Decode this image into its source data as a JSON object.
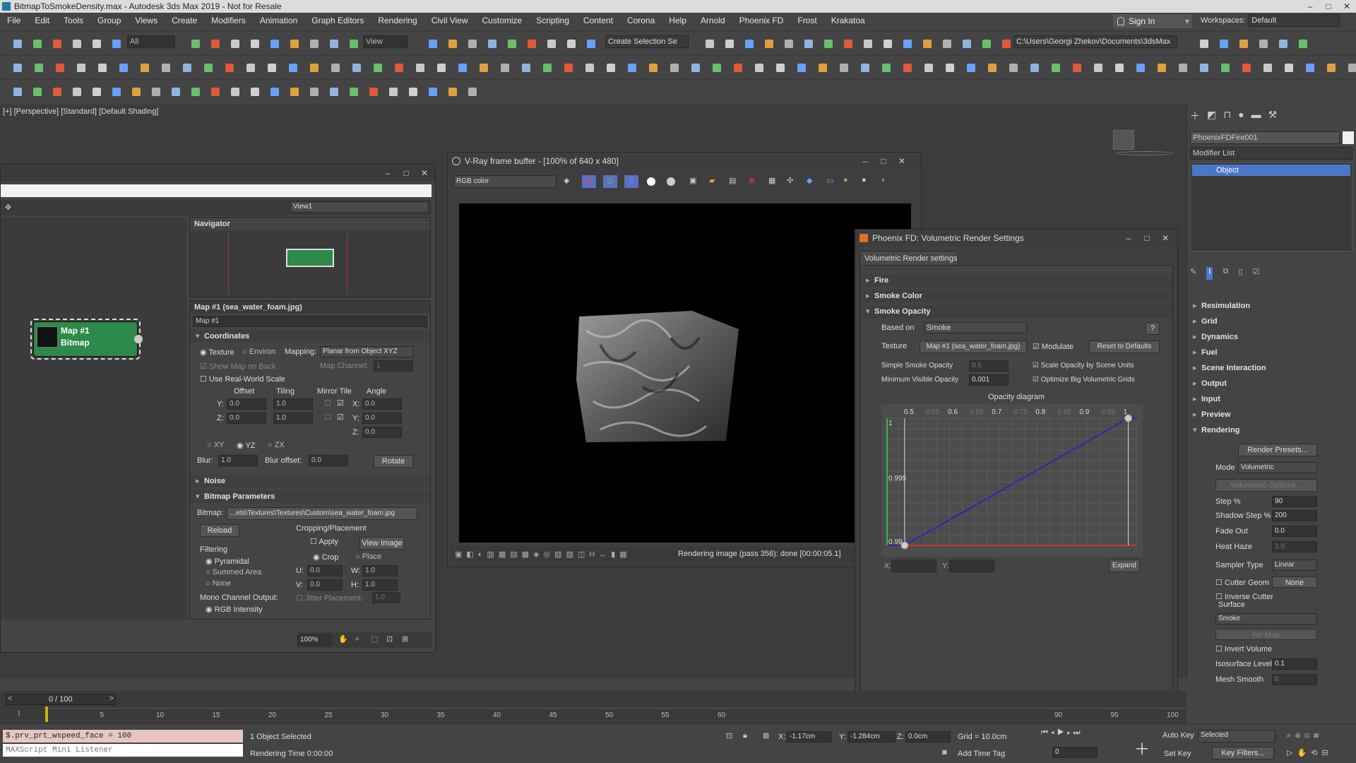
{
  "window": {
    "title": "BitmapToSmokeDensity.max - Autodesk 3ds Max 2019 - Not for Resale",
    "min": "–",
    "max": "□",
    "close": "✕"
  },
  "menu": [
    "File",
    "Edit",
    "Tools",
    "Group",
    "Views",
    "Create",
    "Modifiers",
    "Animation",
    "Graph Editors",
    "Rendering",
    "Civil View",
    "Customize",
    "Scripting",
    "Content",
    "Corona",
    "Help",
    "Arnold",
    "Phoenix FD",
    "Frost",
    "Krakatoa"
  ],
  "signin": "Sign In",
  "workspaces": {
    "label": "Workspaces:",
    "value": "Default"
  },
  "toolbar": {
    "filter": "All",
    "refsys": "View",
    "selset": "Create Selection Se",
    "path": "C:\\Users\\Georgi Zhekov\\Documents\\3dsMax"
  },
  "viewport": {
    "label": "[+] [Perspective] [Standard] [Default Shading]"
  },
  "slate": {
    "viewdd": "View1",
    "navigator": "Navigator",
    "node_line1": "Map #1",
    "node_line2": "Bitmap",
    "zoom": "100%"
  },
  "map": {
    "title": "Map #1 (sea_water_foam.jpg)",
    "name": "Map #1",
    "coordinates": "Coordinates",
    "texture": "Texture",
    "environ": "Environ",
    "mapping_label": "Mapping:",
    "mapping": "Planar from Object XYZ",
    "show_map": "Show Map on Back",
    "map_channel": "Map Channel:",
    "map_channel_val": "1",
    "realworld": "Use Real-World Scale",
    "offset": "Offset",
    "tiling": "Tiling",
    "mirror_tile": "Mirror Tile",
    "angle": "Angle",
    "y": "Y:",
    "z": "Z:",
    "x": "X:",
    "off_y": "0.0",
    "off_z": "0.0",
    "til_y": "1.0",
    "til_z": "1.0",
    "ang_x": "0.0",
    "ang_y": "0.0",
    "ang_z": "0.0",
    "xy": "XY",
    "yz": "YZ",
    "zx": "ZX",
    "blur": "Blur:",
    "blur_val": "1.0",
    "bluroff": "Blur offset:",
    "bluroff_val": "0.0",
    "rotate": "Rotate",
    "noise": "Noise",
    "bitmap_params": "Bitmap Parameters",
    "bitmap_label": "Bitmap:",
    "bitmap_path": "...ets\\Textures\\Textures\\Custom\\sea_water_foam.jpg",
    "reload": "Reload",
    "cropping": "Cropping/Placement",
    "apply": "Apply",
    "view_image": "View Image",
    "crop": "Crop",
    "place": "Place",
    "u": "U:",
    "v": "V:",
    "w": "W:",
    "h": "H:",
    "u_val": "0.0",
    "v_val": "0.0",
    "w_val": "1.0",
    "h_val": "1.0",
    "jitter": "Jitter Placement:",
    "jitter_val": "1.0",
    "filtering": "Filtering",
    "pyramidal": "Pyramidal",
    "summed": "Summed Area",
    "none": "None",
    "mono": "Mono Channel Output:",
    "rgbint": "RGB Intensity"
  },
  "vfb": {
    "title": "V-Ray frame buffer - [100% of 640 x 480]",
    "channel": "RGB color",
    "status": "Rendering image (pass 356): done [00:00:05.1]"
  },
  "phoenix": {
    "title": "Phoenix FD: Volumetric Render Settings",
    "tab": "Volumetric Render settings",
    "fire": "Fire",
    "smoke_color": "Smoke Color",
    "smoke_opacity": "Smoke Opacity",
    "based_on": "Based on",
    "based_val": "Smoke",
    "help": "?",
    "texture": "Texture",
    "texture_map": "Map #1 (sea_water_foam.jpg)",
    "modulate": "Modulate",
    "reset": "Reset to Defaults",
    "simple_opacity": "Simple Smoke Opacity",
    "simple_val": "0.5",
    "scale_opacity": "Scale Opacity by Scene Units",
    "min_visible": "Minimum Visible Opacity",
    "min_val": "0.001",
    "optimize": "Optimize Big Volumetric Grids",
    "diagram_title": "Opacity diagram",
    "ticks": [
      "0.5",
      "0.55",
      "0.6",
      "0.65",
      "0.7",
      "0.75",
      "0.8",
      "0.85",
      "0.9",
      "0.95",
      "1"
    ],
    "yticks": [
      "1",
      "0.995",
      "0.99"
    ],
    "x_label": "X:",
    "y_label": "Y:",
    "expand": "Expand"
  },
  "chart_data": {
    "type": "line",
    "title": "Opacity diagram",
    "xlim": [
      0.45,
      1.02
    ],
    "ylim": [
      0.99,
      1.0
    ],
    "x": [
      0.49,
      1.0
    ],
    "y": [
      0.99,
      1.0
    ],
    "color": "#1f1fd0"
  },
  "cmd": {
    "object_name": "PhoenixFDFire001",
    "modifier_list": "Modifier List",
    "stack_item": "Object",
    "rollouts": [
      "Resimulation",
      "Grid",
      "Dynamics",
      "Fuel",
      "Scene Interaction",
      "Output",
      "Input",
      "Preview",
      "Rendering"
    ],
    "render_presets": "Render Presets...",
    "mode_label": "Mode",
    "mode": "Volumetric",
    "vol_options": "Volumetric Options...",
    "step": "Step %",
    "step_val": "90",
    "shadow_step": "Shadow Step %",
    "shadow_val": "200",
    "fade_out": "Fade Out",
    "fade_val": "0.0",
    "heat_haze": "Heat Haze",
    "heat_val": "1.0",
    "sampler": "Sampler Type",
    "sampler_val": "Linear",
    "cutter": "Cutter Geom",
    "cutter_val": "None",
    "inverse": "Inverse Cutter",
    "surface": "Surface",
    "surface_val": "Smoke",
    "no_map": "No Map",
    "invert_volume": "Invert Volume",
    "iso": "Isosurface Level",
    "iso_val": "0.1",
    "mesh_smooth": "Mesh Smooth",
    "mesh_val": "0"
  },
  "timeline": {
    "frame": "0 / 100",
    "ticks": [
      "5",
      "10",
      "15",
      "20",
      "25",
      "30",
      "35",
      "40",
      "45",
      "50",
      "55",
      "60",
      "90",
      "95",
      "100"
    ]
  },
  "status": {
    "script": "$.prv_prt_wspeed_face = 100",
    "listener": "MAXScript Mini Listener",
    "selected": "1 Object Selected",
    "rtime": "Rendering Time  0:00:00",
    "x_label": "X:",
    "x": "-1.17cm",
    "y_label": "Y:",
    "y": "-1.284cm",
    "z_label": "Z:",
    "z": "0.0cm",
    "grid": "Grid = 10.0cm",
    "add_time_tag": "Add Time Tag",
    "auto_key": "Auto Key",
    "auto_dd": "Selected",
    "set_key": "Set Key",
    "key_filters": "Key Filters...",
    "frame_val": "0"
  }
}
